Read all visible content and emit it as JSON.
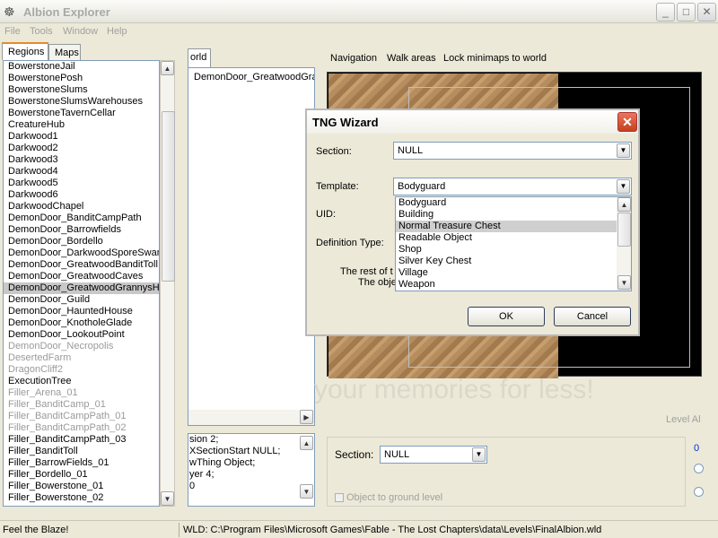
{
  "window": {
    "title": "Albion Explorer",
    "controls": {
      "minimize": "_",
      "maximize": "□",
      "close": "✕"
    }
  },
  "menu": [
    "File",
    "Tools",
    "Window",
    "Help"
  ],
  "left": {
    "tabs": [
      "Regions",
      "Maps"
    ],
    "regions": [
      {
        "label": "BowerstoneJail",
        "state": "normal"
      },
      {
        "label": "BowerstonePosh",
        "state": "normal"
      },
      {
        "label": "BowerstoneSlums",
        "state": "normal"
      },
      {
        "label": "BowerstoneSlumsWarehouses",
        "state": "normal"
      },
      {
        "label": "BowerstoneTavernCellar",
        "state": "normal"
      },
      {
        "label": "CreatureHub",
        "state": "normal"
      },
      {
        "label": "Darkwood1",
        "state": "normal"
      },
      {
        "label": "Darkwood2",
        "state": "normal"
      },
      {
        "label": "Darkwood3",
        "state": "normal"
      },
      {
        "label": "Darkwood4",
        "state": "normal"
      },
      {
        "label": "Darkwood5",
        "state": "normal"
      },
      {
        "label": "Darkwood6",
        "state": "normal"
      },
      {
        "label": "DarkwoodChapel",
        "state": "normal"
      },
      {
        "label": "DemonDoor_BanditCampPath",
        "state": "normal"
      },
      {
        "label": "DemonDoor_Barrowfields",
        "state": "normal"
      },
      {
        "label": "DemonDoor_Bordello",
        "state": "normal"
      },
      {
        "label": "DemonDoor_DarkwoodSporeSwam",
        "state": "normal"
      },
      {
        "label": "DemonDoor_GreatwoodBanditToll",
        "state": "normal"
      },
      {
        "label": "DemonDoor_GreatwoodCaves",
        "state": "normal"
      },
      {
        "label": "DemonDoor_GreatwoodGrannysHo",
        "state": "sel"
      },
      {
        "label": "DemonDoor_Guild",
        "state": "normal"
      },
      {
        "label": "DemonDoor_HauntedHouse",
        "state": "normal"
      },
      {
        "label": "DemonDoor_KnotholeGlade",
        "state": "normal"
      },
      {
        "label": "DemonDoor_LookoutPoint",
        "state": "normal"
      },
      {
        "label": "DemonDoor_Necropolis",
        "state": "dim"
      },
      {
        "label": "DesertedFarm",
        "state": "dim"
      },
      {
        "label": "DragonCliff2",
        "state": "dim"
      },
      {
        "label": "ExecutionTree",
        "state": "normal"
      },
      {
        "label": "Filler_Arena_01",
        "state": "dim"
      },
      {
        "label": "Filler_BanditCamp_01",
        "state": "dim"
      },
      {
        "label": "Filler_BanditCampPath_01",
        "state": "dim"
      },
      {
        "label": "Filler_BanditCampPath_02",
        "state": "dim"
      },
      {
        "label": "Filler_BanditCampPath_03",
        "state": "normal"
      },
      {
        "label": "Filler_BanditToll",
        "state": "normal"
      },
      {
        "label": "Filler_BarrowFields_01",
        "state": "normal"
      },
      {
        "label": "Filler_Bordello_01",
        "state": "normal"
      },
      {
        "label": "Filler_Bowerstone_01",
        "state": "normal"
      },
      {
        "label": "Filler_Bowerstone_02",
        "state": "normal"
      }
    ]
  },
  "middle": {
    "tab": "orld",
    "tree_node": "DemonDoor_GreatwoodGra",
    "code_lines": [
      "sion 2;",
      "XSectionStart NULL;",
      "wThing Object;",
      "yer 4;",
      "0"
    ]
  },
  "right": {
    "nav_links": [
      "Navigation",
      "Walk areas",
      "Lock minimaps to world"
    ],
    "watermark": "your memories for less!",
    "level_label": "Level Al",
    "section_label": "Section:",
    "section_value": "NULL",
    "ground_checkbox": "Object to ground level",
    "side_number": "0"
  },
  "status": {
    "left": "Feel the Blaze!",
    "right": "WLD: C:\\Program Files\\Microsoft Games\\Fable - The Lost Chapters\\data\\Levels\\FinalAlbion.wld"
  },
  "dialog": {
    "title": "TNG Wizard",
    "section_label": "Section:",
    "section_value": "NULL",
    "template_label": "Template:",
    "template_value": "Bodyguard",
    "uid_label": "UID:",
    "def_type_label": "Definition Type:",
    "note_line1": "The rest of t",
    "note_line2": "The obje",
    "template_options": [
      {
        "label": "Bodyguard",
        "selected": false
      },
      {
        "label": "Building",
        "selected": false
      },
      {
        "label": "Normal Treasure Chest",
        "selected": true
      },
      {
        "label": "Readable Object",
        "selected": false
      },
      {
        "label": "Shop",
        "selected": false
      },
      {
        "label": "Silver Key Chest",
        "selected": false
      },
      {
        "label": "Village",
        "selected": false
      },
      {
        "label": "Weapon",
        "selected": false
      }
    ],
    "ok": "OK",
    "cancel": "Cancel"
  }
}
